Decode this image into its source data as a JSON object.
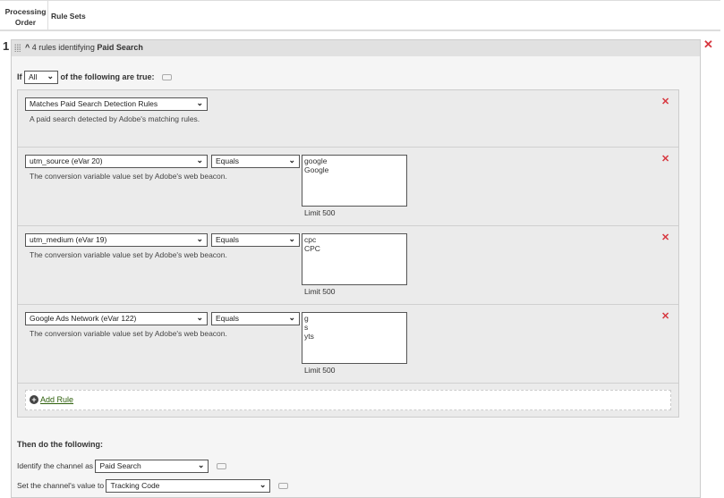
{
  "header": {
    "processing_order": "Processing Order",
    "rule_sets": "Rule Sets"
  },
  "ruleset": {
    "number": "1",
    "title_prefix": "4 rules identifying ",
    "title_channel": "Paid Search",
    "condition": {
      "if_label": "If",
      "match_value": "All",
      "suffix": "of the following are true:"
    },
    "rules": [
      {
        "field": "Matches Paid Search Detection Rules",
        "description": "A paid search detected by Adobe's matching rules."
      },
      {
        "field": "utm_source (eVar 20)",
        "operator": "Equals",
        "values": "google\nGoogle",
        "description": "The conversion variable value set by Adobe's web beacon.",
        "limit": "Limit 500"
      },
      {
        "field": "utm_medium (eVar 19)",
        "operator": "Equals",
        "values": "cpc\nCPC",
        "description": "The conversion variable value set by Adobe's web beacon.",
        "limit": "Limit 500"
      },
      {
        "field": "Google Ads Network (eVar 122)",
        "operator": "Equals",
        "values": "g\ns\nyts",
        "description": "The conversion variable value set by Adobe's web beacon.",
        "limit": "Limit 500"
      }
    ],
    "add_rule": "Add Rule",
    "then_title": "Then do the following:",
    "identify_label": "Identify the channel as",
    "identify_value": "Paid Search",
    "set_value_label": "Set the channel's value to",
    "set_value_value": "Tracking Code"
  },
  "colors": {
    "delete": "#d7373f",
    "link": "#2d5f0a"
  }
}
